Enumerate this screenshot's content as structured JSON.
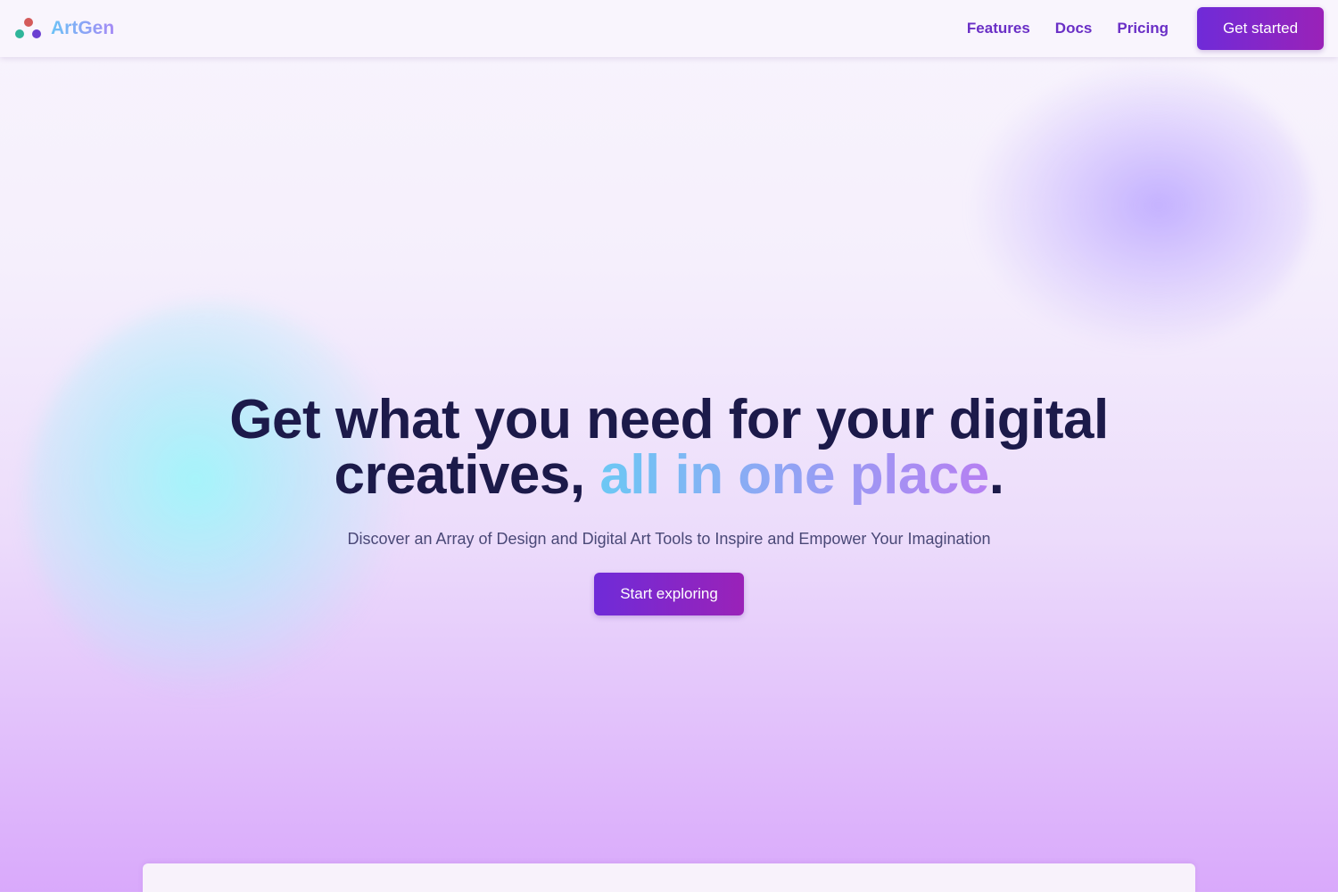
{
  "brand": {
    "name": "ArtGen",
    "logo_icon": "three-dots-logo-icon"
  },
  "nav": {
    "links": [
      "Features",
      "Docs",
      "Pricing"
    ],
    "cta_label": "Get started"
  },
  "hero": {
    "title_part1": "Get what you need for your digital",
    "title_part2": "creatives, ",
    "title_highlight": "all in one place",
    "title_end": ".",
    "subtitle": "Discover an Array of Design and Digital Art Tools to Inspire and Empower Your Imagination",
    "button_label": "Start exploring"
  },
  "colors": {
    "accent_start": "#6f2bd8",
    "accent_end": "#9a22b8",
    "title_text": "#1c1a4a",
    "nav_link": "#6a2fc6"
  }
}
